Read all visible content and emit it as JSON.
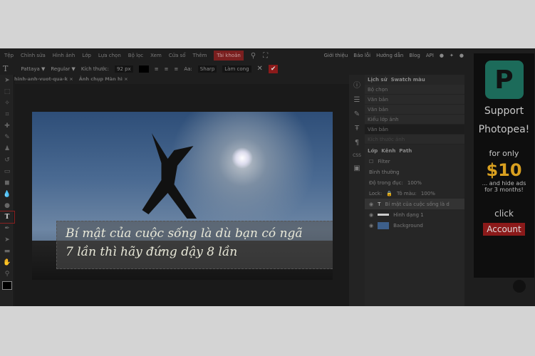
{
  "menu": [
    "Tệp",
    "Chỉnh sửa",
    "Hình ảnh",
    "Lớp",
    "Lựa chọn",
    "Bộ lọc",
    "Xem",
    "Cửa sổ",
    "Thêm",
    "Tài khoản"
  ],
  "right_menu": [
    "Giới thiệu",
    "Báo lỗi",
    "Hướng dẫn",
    "Blog",
    "API"
  ],
  "options": {
    "font": "Pattaya ▼",
    "style": "Regular ▼",
    "size_label": "Kích thước:",
    "size": "92 px",
    "aa_label": "Aa:",
    "aa": "Sharp",
    "warp": "Làm cong"
  },
  "tabs": [
    "hinh-anh-vuot-qua-k ×",
    "Ảnh chụp Màn hì ×"
  ],
  "quote": {
    "line1": "Bí mật của cuộc sống là dù bạn có ngã",
    "line2": "7 lần thì hãy đứng dậy 8 lần"
  },
  "history": {
    "tabs": [
      "Lịch sử",
      "Swatch màu"
    ],
    "items": [
      "Bộ chọn",
      "Văn bản",
      "Văn bản",
      "Kiểu lớp ảnh",
      "Văn bản",
      "Kích thước ảnh"
    ]
  },
  "layers": {
    "tabs": [
      "Lớp",
      "Kênh",
      "Path"
    ],
    "filter": "Filter",
    "blend": "Bình thường",
    "opacity_label": "Độ trong đục:",
    "opacity": "100%",
    "lock_label": "Lock:",
    "fill_label": "Tô màu:",
    "fill": "100%",
    "items": [
      "Bí mật của cuộc sống là d",
      "Hình dạng 1",
      "Background"
    ]
  },
  "ad": {
    "line1": "Support",
    "line2": "Photopea!",
    "line3": "for only",
    "price": "$10",
    "line4": "... and hide ads for 3 months!",
    "line5": "click",
    "button": "Account"
  },
  "colors": {
    "accent": "#8b1a1a",
    "ad_price": "#d9a020",
    "logo": "#1c6b5a"
  }
}
